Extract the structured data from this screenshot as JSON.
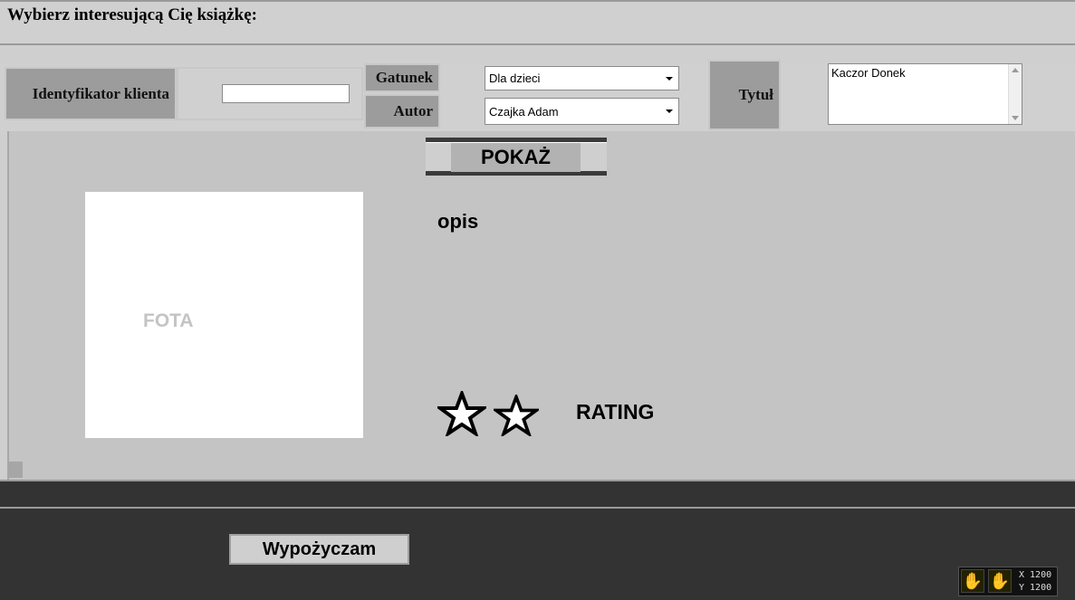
{
  "header": {
    "title": "Wybierz interesującą Cię książkę:"
  },
  "form": {
    "client_id_label": "Identyfikator klienta",
    "client_id_value": "",
    "genre_label": "Gatunek",
    "genre_selected": "Dla dzieci",
    "author_label": "Autor",
    "author_selected": "Czajka Adam",
    "title_label": "Tytuł",
    "title_value": "Kaczor Donek"
  },
  "details": {
    "show_button": "POKAŻ",
    "photo_label": "FOTA",
    "description_label": "opis",
    "rating_label": "RATING",
    "rating_stars": 2
  },
  "footer": {
    "rent_button": "Wypożyczam",
    "coords": {
      "x_label": "X 1200",
      "y_label": "Y 1200"
    }
  },
  "colors": {
    "panel": "#c4c4c4",
    "dark_band": "#333333",
    "label_cell": "#9c9c9c"
  },
  "icons": [
    "dropdown-arrow-icon",
    "star-icon",
    "scroll-up-icon",
    "scroll-down-icon",
    "hand-icon"
  ]
}
